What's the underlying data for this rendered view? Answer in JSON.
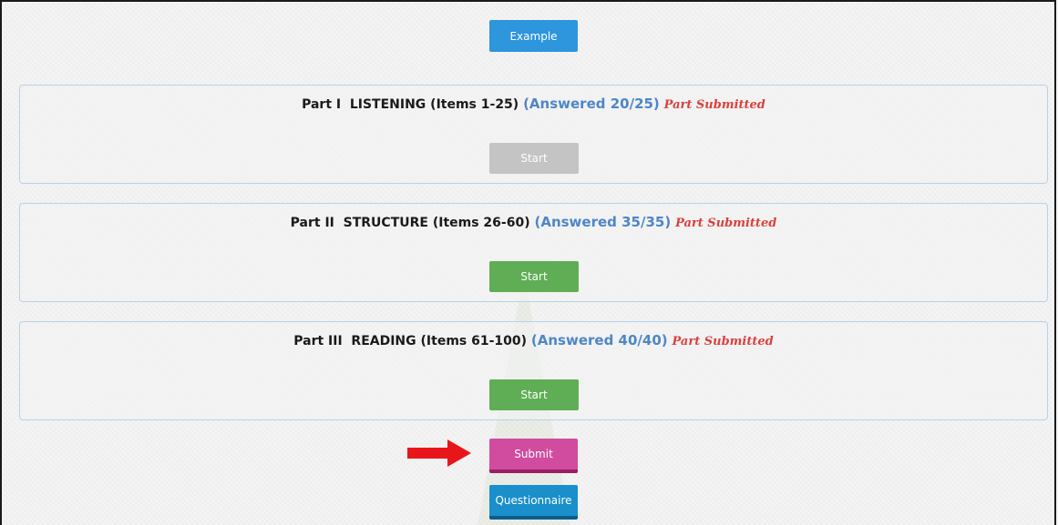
{
  "example_button": {
    "label": "Example"
  },
  "parts": [
    {
      "title": "Part I  LISTENING (Items 1-25)",
      "answered": "(Answered 20/25)",
      "status": "Part Submitted",
      "start_label": "Start",
      "start_state": "disabled"
    },
    {
      "title": "Part II  STRUCTURE (Items 26-60)",
      "answered": "(Answered 35/35)",
      "status": "Part Submitted",
      "start_label": "Start",
      "start_state": "enabled"
    },
    {
      "title": "Part III  READING (Items 61-100)",
      "answered": "(Answered 40/40)",
      "status": "Part Submitted",
      "start_label": "Start",
      "start_state": "enabled"
    }
  ],
  "submit_button": {
    "label": "Submit"
  },
  "questionnaire_button": {
    "label": "Questionnaire"
  },
  "annotation": {
    "icon": "red-arrow-icon",
    "color": "#e8161b"
  },
  "colors": {
    "example": "#2d96dc",
    "start_enabled": "#5fae55",
    "start_disabled": "#c4c4c4",
    "submit": "#d14c9f",
    "questionnaire": "#1a8fcb",
    "answered_text": "#4f86c6",
    "submitted_text": "#d9413d"
  }
}
